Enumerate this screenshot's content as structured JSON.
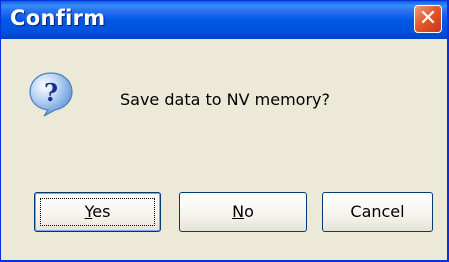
{
  "window": {
    "title": "Confirm",
    "close_glyph": "✕"
  },
  "dialog": {
    "icon": "question-icon",
    "message": "Save data to NV memory?"
  },
  "buttons": {
    "yes": {
      "mnemonic": "Y",
      "rest": "es"
    },
    "no": {
      "mnemonic": "N",
      "rest": "o"
    },
    "cancel": {
      "label": "Cancel"
    }
  },
  "colors": {
    "titlebar": "#0058e6",
    "close_button": "#e35a2a",
    "dialog_bg": "#ece9d8",
    "button_border": "#003c74"
  }
}
